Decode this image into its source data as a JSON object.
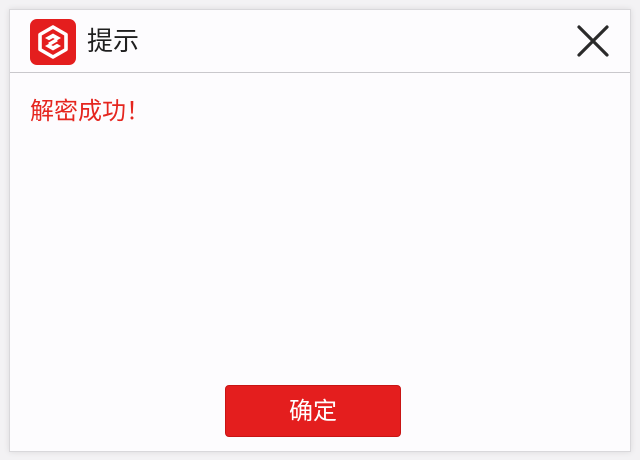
{
  "dialog": {
    "title": "提示",
    "logo_icon": "app-logo-icon",
    "close_icon": "close-icon",
    "message": "解密成功！",
    "confirm_label": "确定"
  },
  "colors": {
    "accent": "#e41e1e",
    "message_text": "#e5261f",
    "title_text": "#1f1f1f"
  }
}
